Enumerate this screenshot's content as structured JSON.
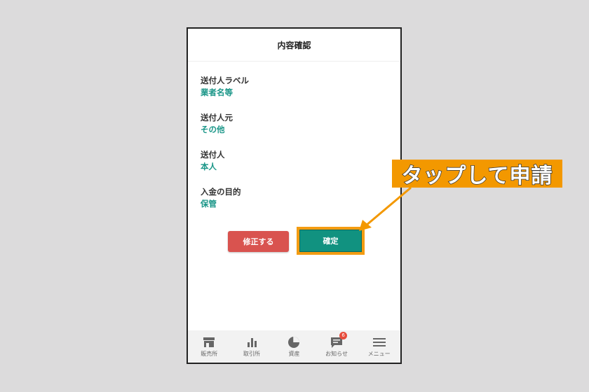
{
  "header": {
    "title": "内容確認"
  },
  "fields": [
    {
      "label": "送付人ラベル",
      "value": "業者名等"
    },
    {
      "label": "送付人元",
      "value": "その他"
    },
    {
      "label": "送付人",
      "value": "本人"
    },
    {
      "label": "入金の目的",
      "value": "保管"
    }
  ],
  "buttons": {
    "edit_label": "修正する",
    "confirm_label": "確定"
  },
  "nav": {
    "items": [
      {
        "label": "販売所",
        "icon": "store-icon"
      },
      {
        "label": "取引所",
        "icon": "bar-chart-icon"
      },
      {
        "label": "資産",
        "icon": "pie-chart-icon"
      },
      {
        "label": "お知らせ",
        "icon": "chat-icon",
        "badge": "6"
      },
      {
        "label": "メニュー",
        "icon": "hamburger-menu-icon"
      }
    ]
  },
  "annotation": {
    "text": "タップして申請"
  },
  "colors": {
    "accent": "#119280",
    "danger": "#d9534f",
    "highlight": "#f39800"
  }
}
